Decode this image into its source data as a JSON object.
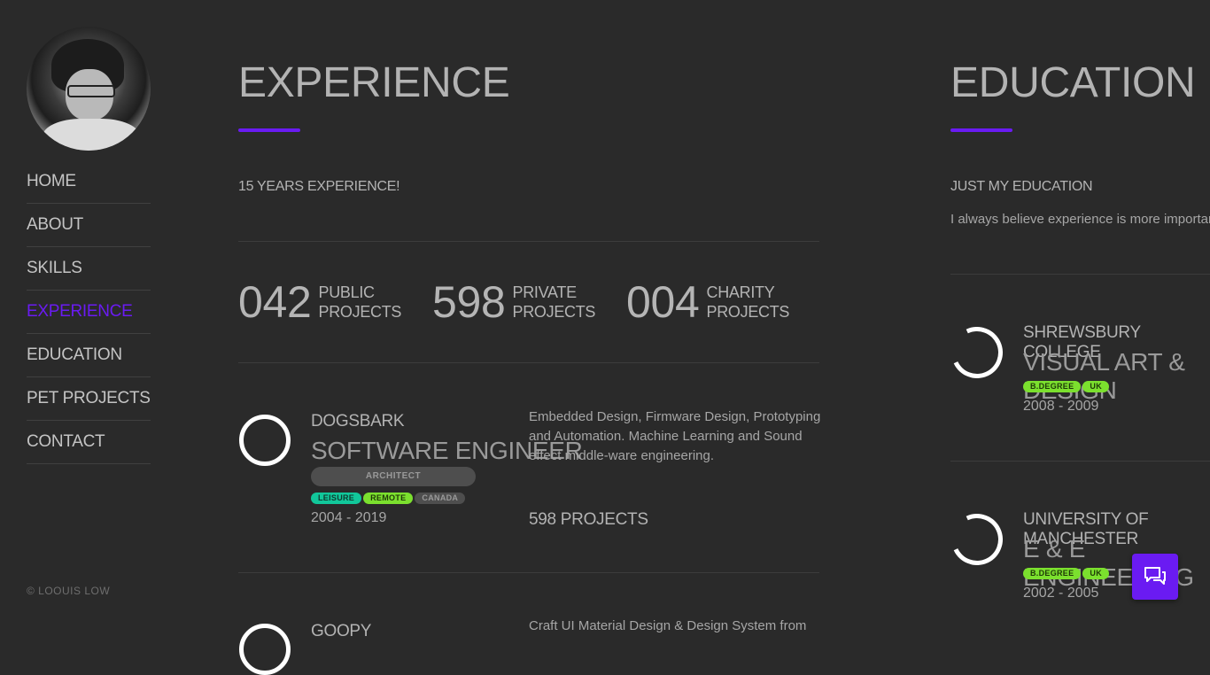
{
  "sidebar": {
    "nav": [
      "HOME",
      "ABOUT",
      "SKILLS",
      "EXPERIENCE",
      "EDUCATION",
      "PET PROJECTS",
      "CONTACT"
    ],
    "active": "EXPERIENCE",
    "copyright": "© LOOUIS LOW"
  },
  "experience": {
    "title": "EXPERIENCE",
    "subtitle": "15 YEARS EXPERIENCE!",
    "stats": [
      {
        "num": "042",
        "line1": "PUBLIC",
        "line2": "PROJECTS"
      },
      {
        "num": "598",
        "line1": "PRIVATE",
        "line2": "PROJECTS"
      },
      {
        "num": "004",
        "line1": "CHARITY",
        "line2": "PROJECTS"
      }
    ],
    "jobs": [
      {
        "company": "DOGSBARK",
        "role": "SOFTWARE ENGINEER",
        "badge": "ARCHITECT",
        "tags": [
          "LEISURE",
          "REMOTE",
          "CANADA"
        ],
        "years": "2004 - 2019",
        "description": "Embedded Design, Firmware Design, Prototyping and Automation. Machine Learning and Sound effect middle-ware engineering.",
        "projects": "598 PROJECTS"
      },
      {
        "company": "GOOPY",
        "description": "Craft UI Material Design & Design System from"
      }
    ]
  },
  "education": {
    "title": "EDUCATION",
    "subtitle": "JUST MY EDUCATION",
    "intro": "I always believe experience is more importar",
    "schools": [
      {
        "name": "SHREWSBURY COLLEGE",
        "course": "VISUAL ART & DESIGN",
        "tags": [
          "B.DEGREE",
          "UK"
        ],
        "years": "2008 - 2009"
      },
      {
        "name": "UNIVERSITY OF MANCHESTER",
        "course": "E & E ENGINEERING",
        "tags": [
          "B.DEGREE",
          "UK"
        ],
        "years": "2002 - 2005"
      }
    ]
  },
  "colors": {
    "accent": "#6a1bf2",
    "background": "#2a2a2a",
    "tag_green": "#7be02e",
    "tag_teal": "#11c79a"
  },
  "icons": {
    "chat": "chat-bubbles-icon"
  }
}
